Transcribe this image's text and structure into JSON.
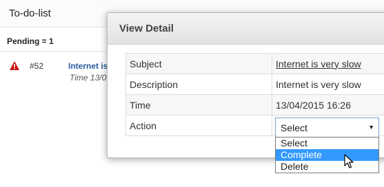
{
  "todo": {
    "title": "To-do-list",
    "pending_label": "Pending = 1",
    "items": [
      {
        "id": "#52",
        "subject": "Internet is",
        "time": "Time 13/0"
      }
    ]
  },
  "modal": {
    "title": "View Detail",
    "rows": [
      {
        "label": "Subject",
        "value": "Internet is very slow"
      },
      {
        "label": "Description",
        "value": "Internet is very slow"
      },
      {
        "label": "Time",
        "value": "13/04/2015 16:26"
      },
      {
        "label": "Action",
        "value": ""
      }
    ],
    "action_select": {
      "selected": "Select",
      "options": [
        "Select",
        "Complete",
        "Delete"
      ],
      "highlighted": "Complete"
    }
  },
  "icons": {
    "warning": "warning-icon",
    "cursor": "mouse-pointer-icon"
  },
  "colors": {
    "link": "#2a5a9c",
    "highlight": "#3399ff",
    "warning": "#cc1111"
  }
}
